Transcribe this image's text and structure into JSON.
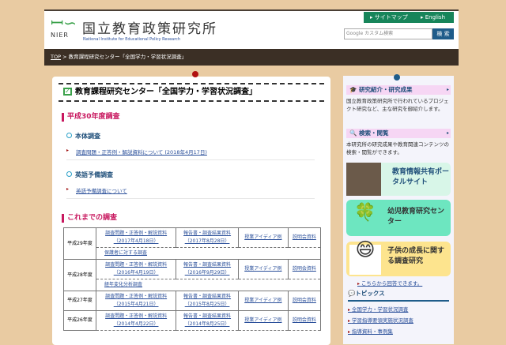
{
  "header": {
    "logo_text": "NIER",
    "title": "国立教育政策研究所",
    "subtitle": "National Institute for Educational Policy Research",
    "sitemap": "▸ サイトマップ",
    "english": "▸ English",
    "search_placeholder": "Google カスタム検索",
    "search_button": "検 索"
  },
  "breadcrumb": {
    "top": "TOP",
    "sep": " > ",
    "current": "教育課程研究センター「全国学力・学習状況調査」"
  },
  "main": {
    "title": "教育課程研究センター「全国学力・学習状況調査」",
    "section1": "平成30年度調査",
    "sub1": "本体調査",
    "sub1_link": "調査問題・正答例・解説資料について (2018年4月17日)",
    "sub2": "英語予備調査",
    "sub2_link": "英語予備調査について",
    "section2": "これまでの調査",
    "rows": [
      {
        "year": "平成29年度",
        "c1": "調査問題・正答例・解説資料",
        "c1d": "（2017年4月18日）",
        "c2": "報告書・調査結果資料",
        "c2d": "（2017年8月28日）",
        "c3": "授業アイディア例",
        "c4": "説明会資料",
        "extra": "保護者に対する調査"
      },
      {
        "year": "平成28年度",
        "c1": "調査問題・正答例・解説資料",
        "c1d": "（2016年4月19日）",
        "c2": "報告書・調査結果資料",
        "c2d": "（2016年9月29日）",
        "c3": "授業アイディア例",
        "c4": "説明会資料",
        "extra": "経年変化分析調査"
      },
      {
        "year": "平成27年度",
        "c1": "調査問題・正答例・解説資料",
        "c1d": "（2015年4月21日）",
        "c2": "報告書・調査結果資料",
        "c2d": "（2015年8月25日）",
        "c3": "授業アイディア例",
        "c4": "説明会資料"
      },
      {
        "year": "平成26年度",
        "c1": "調査問題・正答例・解説資料",
        "c1d": "（2014年4月22日）",
        "c2": "報告書・調査結果資料",
        "c2d": "（2014年8月25日）",
        "c3": "授業アイディア例",
        "c4": "説明会資料"
      }
    ]
  },
  "sidebar": {
    "research_title": "研究紹介・研究成果",
    "research_desc": "国立教育政策研究所で行われているプロジェクト研究など、主な研究を御紹介します。",
    "search_title": "検索・閲覧",
    "search_desc": "本研究所の研究成果や教育関連コンテンツの検索・閲覧ができます。",
    "portal": "教育情報共有ポータルサイト",
    "early": "幼児教育研究センター",
    "child": "子供の成長に関する調査研究",
    "child_link": "こちらから回答できます。",
    "topics_title": "トピックス",
    "topics": [
      "全国学力・学習状況調査",
      "学習指導要領実施状況調査",
      "指導資料・事例集"
    ]
  }
}
